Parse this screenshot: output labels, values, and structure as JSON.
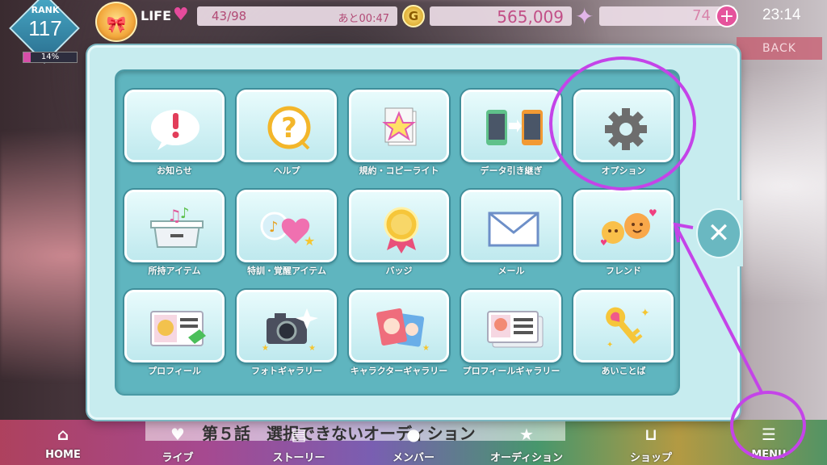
{
  "status": {
    "rank_label": "RANK",
    "rank_value": "117",
    "rank_progress_label": "14%",
    "rank_progress": 0.14,
    "life_label": "LIFE",
    "life_count": "43/98",
    "life_timer": "あと00:47",
    "gold_symbol": "G",
    "gold_value": "565,009",
    "gem_value": "74",
    "gem_plus": "+",
    "clock": "23:14",
    "back_label": "BACK"
  },
  "menu": {
    "tiles": [
      {
        "label": "お知らせ",
        "icon": "notice-bubble-icon"
      },
      {
        "label": "ヘルプ",
        "icon": "help-question-icon"
      },
      {
        "label": "規約・コピーライト",
        "icon": "terms-document-icon"
      },
      {
        "label": "データ引き継ぎ",
        "icon": "data-transfer-phones-icon"
      },
      {
        "label": "オプション",
        "icon": "gear-icon"
      },
      {
        "label": "所持アイテム",
        "icon": "item-box-icon"
      },
      {
        "label": "特訓・覚醒アイテム",
        "icon": "training-heart-icon"
      },
      {
        "label": "バッジ",
        "icon": "badge-medal-icon"
      },
      {
        "label": "メール",
        "icon": "mail-envelope-icon"
      },
      {
        "label": "フレンド",
        "icon": "friend-faces-icon"
      },
      {
        "label": "プロフィール",
        "icon": "profile-card-icon"
      },
      {
        "label": "フォトギャラリー",
        "icon": "camera-icon"
      },
      {
        "label": "キャラクターギャラリー",
        "icon": "character-cards-icon"
      },
      {
        "label": "プロフィールギャラリー",
        "icon": "profile-gallery-icon"
      },
      {
        "label": "あいことば",
        "icon": "key-icon"
      }
    ],
    "close_symbol": "✕"
  },
  "bottom_nav": {
    "news_text": "第５話　選択できないオーディション",
    "items": [
      {
        "label": "HOME",
        "icon": "home-icon"
      },
      {
        "label": "ライブ",
        "icon": "live-heart-icon"
      },
      {
        "label": "ストーリー",
        "icon": "story-book-icon"
      },
      {
        "label": "メンバー",
        "icon": "member-icon"
      },
      {
        "label": "オーディション",
        "icon": "audition-star-icon"
      },
      {
        "label": "ショップ",
        "icon": "shop-basket-icon"
      },
      {
        "label": "MENU",
        "icon": "menu-list-icon"
      }
    ]
  },
  "colors": {
    "accent_pink": "#e5539c",
    "panel_bg": "#c7ecef",
    "panel_inner": "#5fb5bf",
    "highlight": "#c444e8"
  }
}
